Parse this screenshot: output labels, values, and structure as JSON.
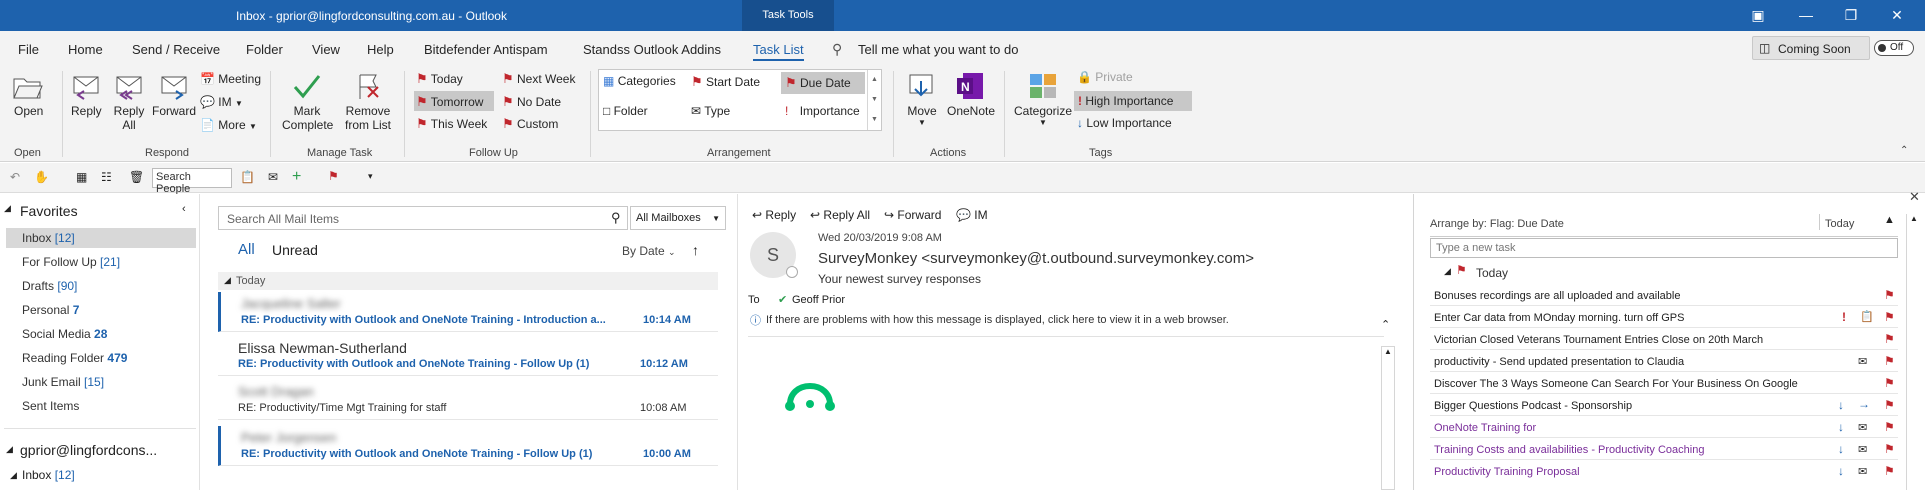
{
  "window": {
    "title": "Inbox - gprior@lingfordconsulting.com.au  -  Outlook",
    "context_tab": "Task Tools"
  },
  "menu": [
    "File",
    "Home",
    "Send / Receive",
    "Folder",
    "View",
    "Help",
    "Bitdefender Antispam",
    "Standss Outlook Addins",
    "Task List"
  ],
  "tell_me": "Tell me what you want to do",
  "coming_soon": "Coming Soon",
  "toggle_off": "Off",
  "ribbon": {
    "open": "Open",
    "open_group": "Open",
    "reply": "Reply",
    "reply_all_1": "Reply",
    "reply_all_2": "All",
    "forward": "Forward",
    "meeting": "Meeting",
    "im": "IM",
    "more": "More",
    "respond_group": "Respond",
    "mark_complete_1": "Mark",
    "mark_complete_2": "Complete",
    "remove_1": "Remove",
    "remove_2": "from List",
    "manage_group": "Manage Task",
    "today": "Today",
    "tomorrow": "Tomorrow",
    "this_week": "This Week",
    "next_week": "Next Week",
    "no_date": "No Date",
    "custom": "Custom",
    "followup_group": "Follow Up",
    "categories": "Categories",
    "start_date": "Start Date",
    "due_date": "Due Date",
    "folder": "Folder",
    "type": "Type",
    "importance": "Importance",
    "arrangement_group": "Arrangement",
    "move": "Move",
    "onenote": "OneNote",
    "actions_group": "Actions",
    "categorize": "Categorize",
    "private": "Private",
    "high_importance": "High Importance",
    "low_importance": "Low Importance",
    "tags_group": "Tags"
  },
  "qat": {
    "search_people": "Search People"
  },
  "nav": {
    "favorites": "Favorites",
    "items": [
      {
        "label": "Inbox",
        "count": "[12]"
      },
      {
        "label": "For Follow Up",
        "count": "[21]"
      },
      {
        "label": "Drafts",
        "count": "[90]"
      },
      {
        "label": "Personal",
        "count": "7"
      },
      {
        "label": "Social Media",
        "count": "28"
      },
      {
        "label": "Reading Folder",
        "count": "479"
      },
      {
        "label": "Junk Email",
        "count": "[15]"
      },
      {
        "label": "Sent Items",
        "count": ""
      }
    ],
    "account": "gprior@lingfordcons...",
    "account_inbox": "Inbox",
    "account_inbox_count": "[12]"
  },
  "list": {
    "search_placeholder": "Search All Mail Items",
    "scope": "All Mailboxes",
    "tab_all": "All",
    "tab_unread": "Unread",
    "sort": "By Date",
    "group_today": "Today",
    "messages": [
      {
        "sender": "Jacqueline Salter",
        "subject": "RE: Productivity with Outlook and OneNote Training  - Introduction a...",
        "time": "10:14 AM"
      },
      {
        "sender": "Elissa Newman-Sutherland",
        "subject": "RE: Productivity with Outlook and OneNote Training - Follow Up (1)",
        "time": "10:12 AM"
      },
      {
        "sender": "Scott Dragan",
        "subject": "RE: Productivity/Time Mgt Training for staff",
        "time": "10:08 AM"
      },
      {
        "sender": "Peter Jorgensen",
        "subject": "RE: Productivity with Outlook and OneNote Training - Follow Up (1)",
        "time": "10:00 AM"
      }
    ]
  },
  "reading": {
    "reply": "Reply",
    "reply_all": "Reply All",
    "forward": "Forward",
    "im": "IM",
    "avatar_initial": "S",
    "date": "Wed 20/03/2019 9:08 AM",
    "from": "SurveyMonkey <surveymonkey@t.outbound.surveymonkey.com>",
    "subject": "Your newest survey responses",
    "to_label": "To",
    "to": "Geoff Prior",
    "info": "If there are problems with how this message is displayed, click here to view it in a web browser."
  },
  "tasks": {
    "arrange_by": "Arrange by: Flag: Due Date",
    "arrange_value": "Today",
    "new_task_placeholder": "Type a new task",
    "group_today": "Today",
    "items": [
      {
        "text": "Bonuses recordings are all uploaded and available",
        "purple": false
      },
      {
        "text": "Enter Car data from MOnday morning. turn off GPS",
        "purple": false
      },
      {
        "text": "Victorian Closed Veterans Tournament Entries Close on 20th March",
        "purple": false
      },
      {
        "text": "productivity - Send updated presentation to Claudia",
        "purple": false
      },
      {
        "text": "Discover The 3 Ways Someone Can Search For Your Business On Google",
        "purple": false
      },
      {
        "text": "Bigger Questions Podcast - Sponsorship",
        "purple": false
      },
      {
        "text": "OneNote Training for",
        "purple": true
      },
      {
        "text": "Training Costs and availabilities - Productivity Coaching",
        "purple": true
      },
      {
        "text": "Productivity Training Proposal",
        "purple": true
      }
    ]
  },
  "colors": {
    "accent": "#1e62ad",
    "flag": "#c0262d",
    "purple": "#7a2e9a"
  }
}
